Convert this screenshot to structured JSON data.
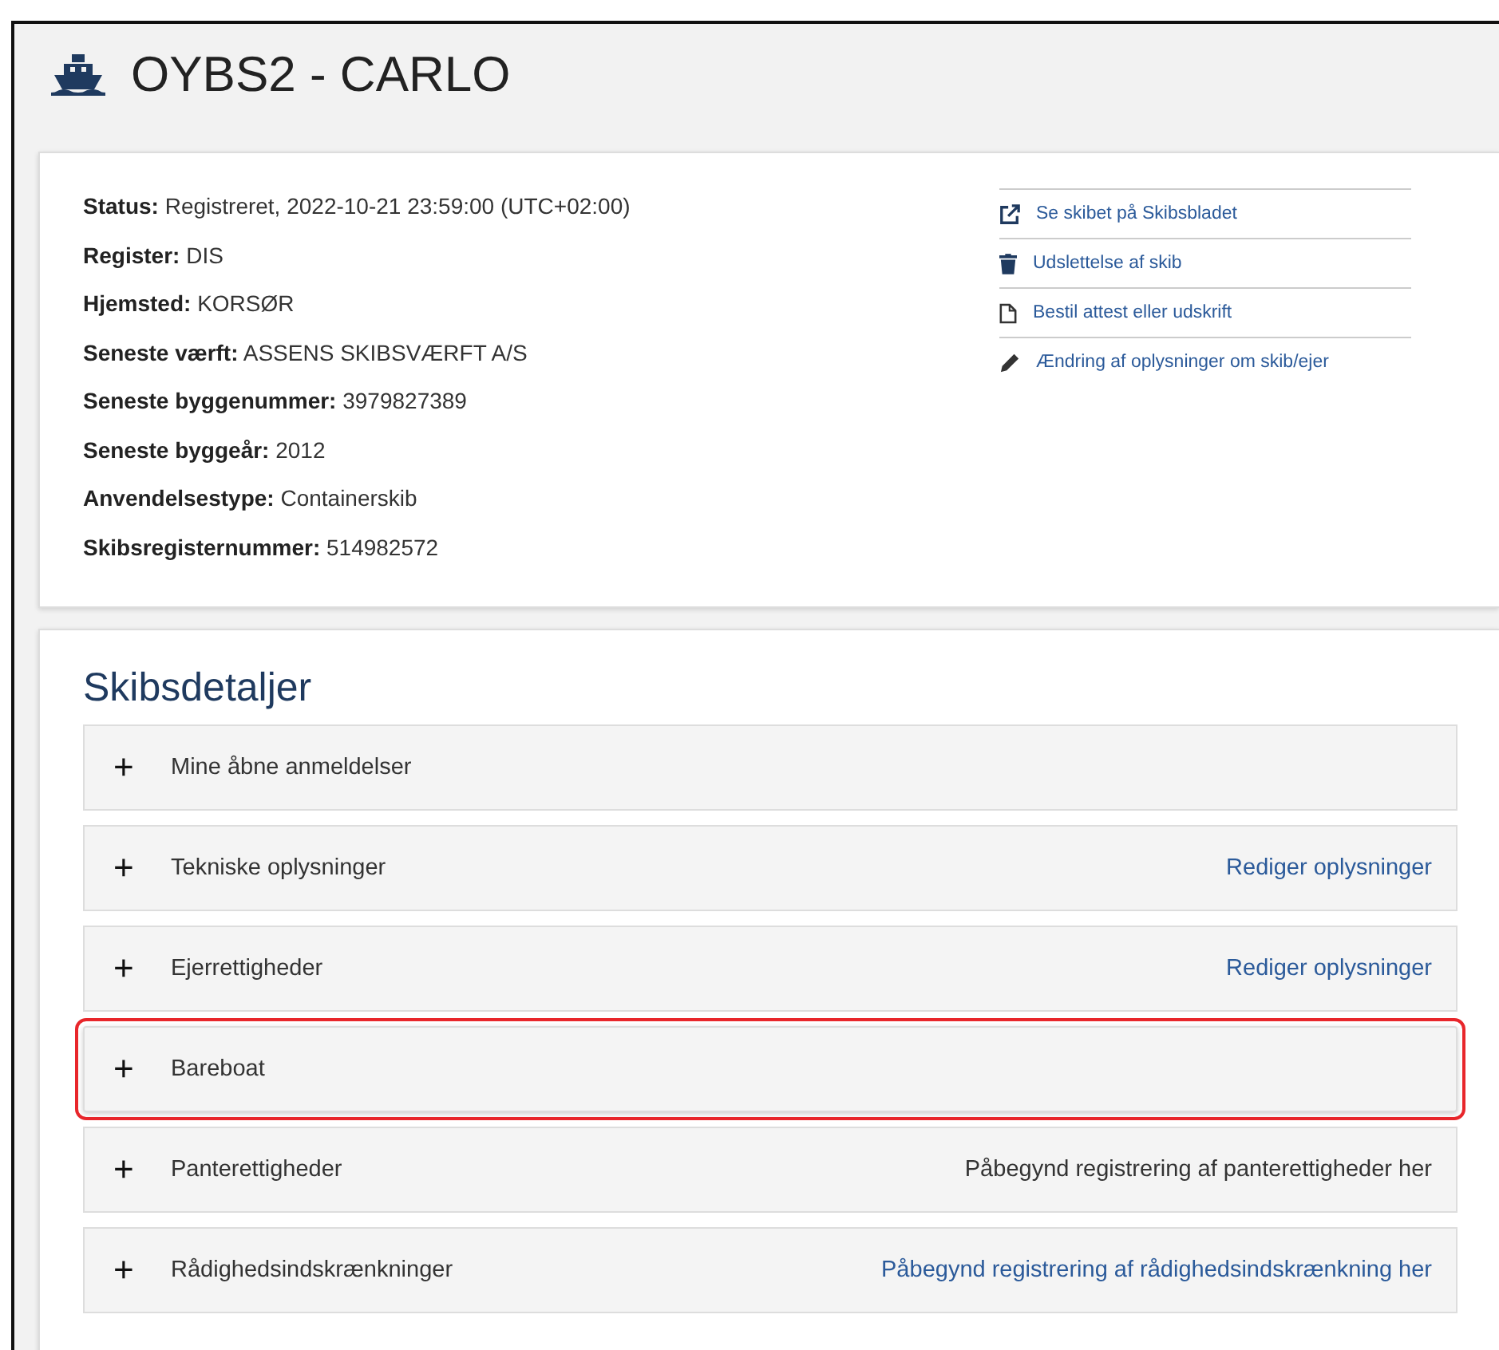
{
  "title": "OYBS2 - CARLO",
  "fields": [
    {
      "label": "Status:",
      "value": "Registreret, 2022-10-21 23:59:00 (UTC+02:00)"
    },
    {
      "label": "Register:",
      "value": "DIS"
    },
    {
      "label": "Hjemsted:",
      "value": "KORSØR"
    },
    {
      "label": "Seneste værft:",
      "value": "ASSENS SKIBSVÆRFT A/S"
    },
    {
      "label": "Seneste byggenummer:",
      "value": "3979827389"
    },
    {
      "label": "Seneste byggeår:",
      "value": "2012"
    },
    {
      "label": "Anvendelsestype:",
      "value": "Containerskib"
    },
    {
      "label": "Skibsregisternummer:",
      "value": "514982572"
    }
  ],
  "links": [
    {
      "kind": "external",
      "label": "Se skibet på Skibsbladet"
    },
    {
      "kind": "delete",
      "label": "Udslettelse af skib"
    },
    {
      "kind": "order",
      "label": "Bestil attest eller udskrift"
    },
    {
      "kind": "edit",
      "label": "Ændring af oplysninger om skib/ejer"
    }
  ],
  "details": {
    "heading": "Skibsdetaljer",
    "sections": [
      {
        "toggle": "+",
        "label": "Mine åbne anmeldelser",
        "highlighted": false
      },
      {
        "toggle": "+",
        "label": "Tekniske oplysninger",
        "highlighted": false,
        "action": {
          "kind": "link",
          "label": "Rediger oplysninger"
        }
      },
      {
        "toggle": "+",
        "label": "Ejerrettigheder",
        "highlighted": false,
        "action": {
          "kind": "link",
          "label": "Rediger oplysninger"
        }
      },
      {
        "toggle": "+",
        "label": "Bareboat",
        "highlighted": true
      },
      {
        "toggle": "+",
        "label": "Panterettigheder",
        "highlighted": false,
        "action": {
          "kind": "text",
          "label": "Påbegynd registrering af panterettigheder her"
        }
      },
      {
        "toggle": "+",
        "label": "Rådighedsindskrænkninger",
        "highlighted": false,
        "action": {
          "kind": "link",
          "label": "Påbegynd registrering af rådighedsindskrænkning her"
        }
      }
    ]
  }
}
